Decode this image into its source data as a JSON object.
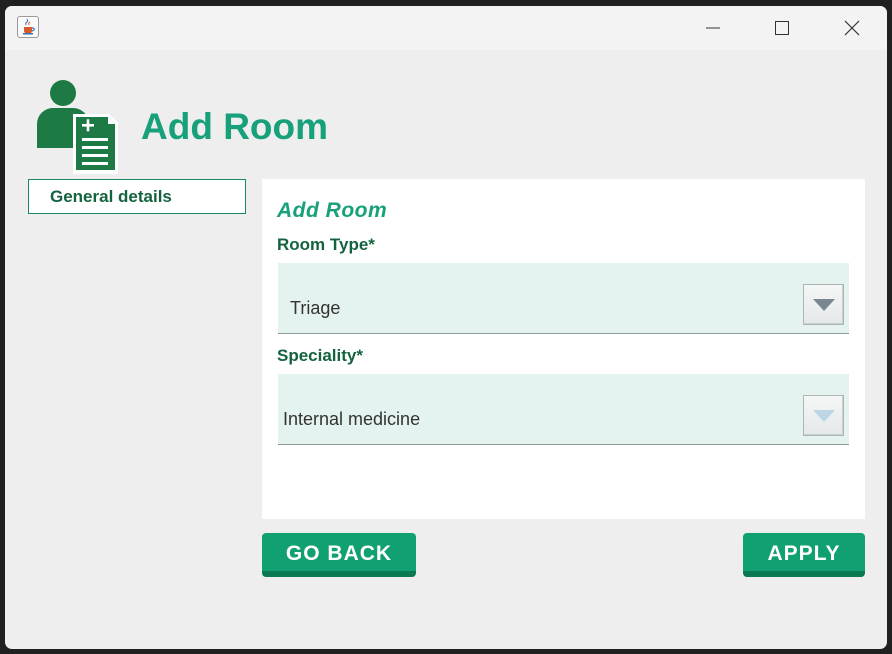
{
  "window": {
    "controls": [
      "minimize-icon",
      "maximize-icon",
      "close-icon"
    ],
    "app_icon": "java-cup-icon"
  },
  "header": {
    "title": "Add Room",
    "icon": "user-document-icon"
  },
  "sidebar": {
    "tabs": [
      {
        "label": "General details",
        "selected": true
      }
    ]
  },
  "form": {
    "section_title": "Add Room",
    "fields": [
      {
        "label": "Room Type*",
        "value": "Triage",
        "enabled": true
      },
      {
        "label": "Speciality*",
        "value": "Internal medicine",
        "enabled": false
      }
    ]
  },
  "buttons": {
    "back_label": "GO BACK",
    "apply_label": "APPLY"
  },
  "colors": {
    "accent": "#17a07a",
    "label": "#14633f",
    "button": "#11a071",
    "field_bg": "#e4f3ef"
  }
}
